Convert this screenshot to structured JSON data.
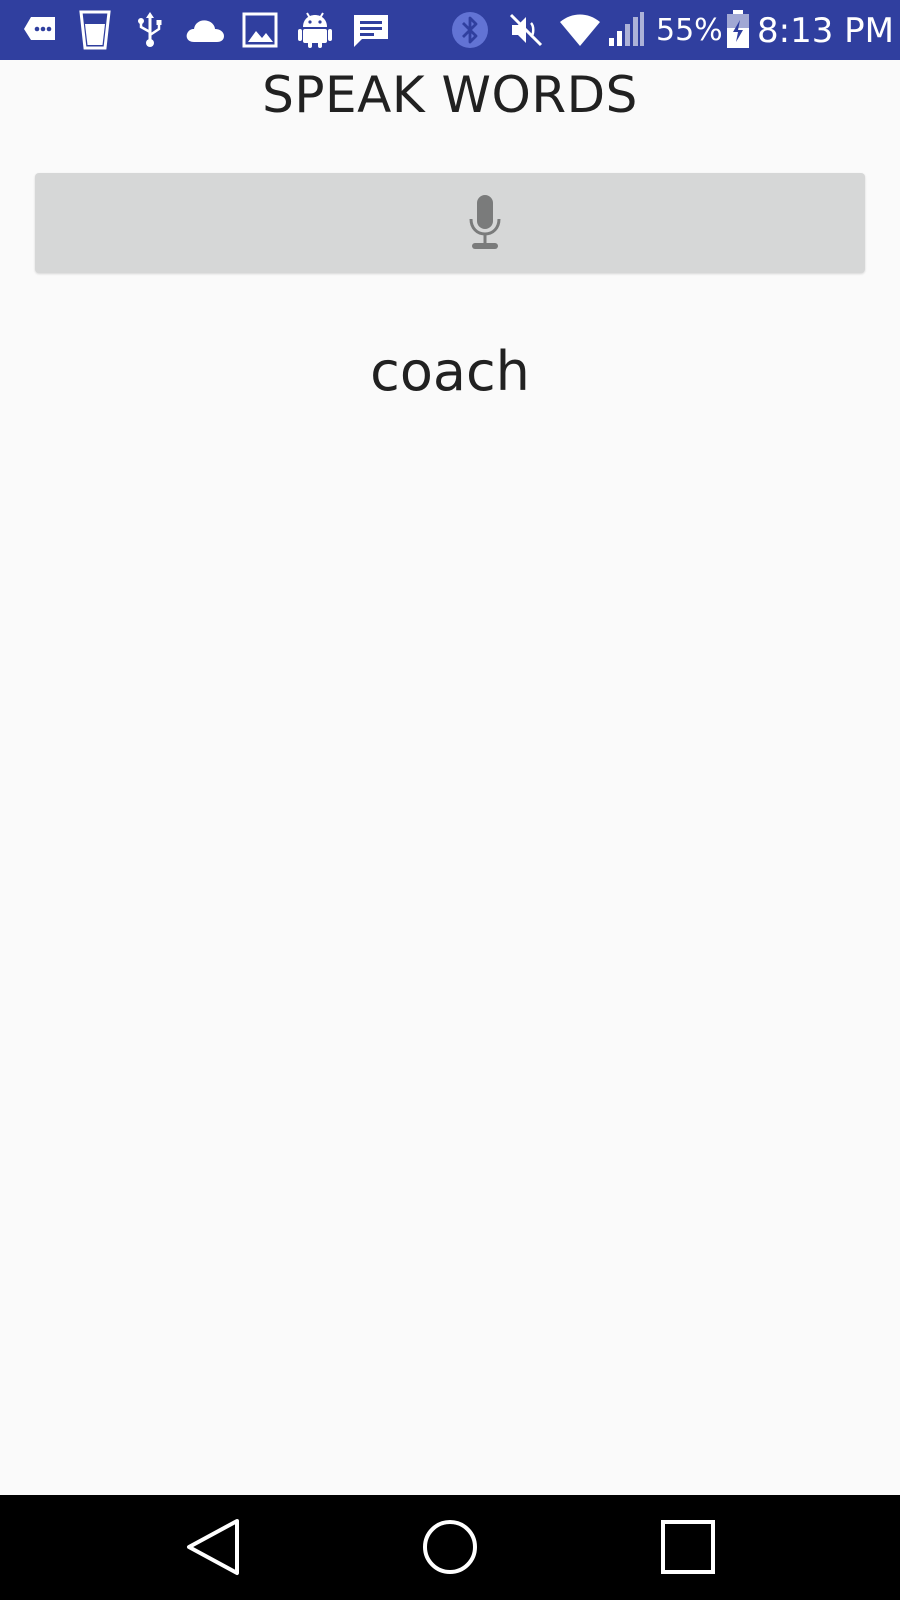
{
  "status_bar": {
    "background_color": "#303f9f",
    "notification_icons": [
      "more-messages-icon",
      "cup-icon",
      "usb-icon",
      "cloud-icon",
      "image-icon",
      "android-icon",
      "chat-icon"
    ],
    "system_icons": [
      "bluetooth-icon",
      "mute-icon",
      "wifi-icon",
      "signal-icon",
      "battery-charging-icon"
    ],
    "battery_text": "55%",
    "time": "8:13 PM"
  },
  "app": {
    "title": "SPEAK WORDS",
    "mic_button_icon": "microphone-icon",
    "word": "coach"
  },
  "nav_bar": {
    "buttons": [
      "back-icon",
      "home-icon",
      "recents-icon"
    ]
  }
}
